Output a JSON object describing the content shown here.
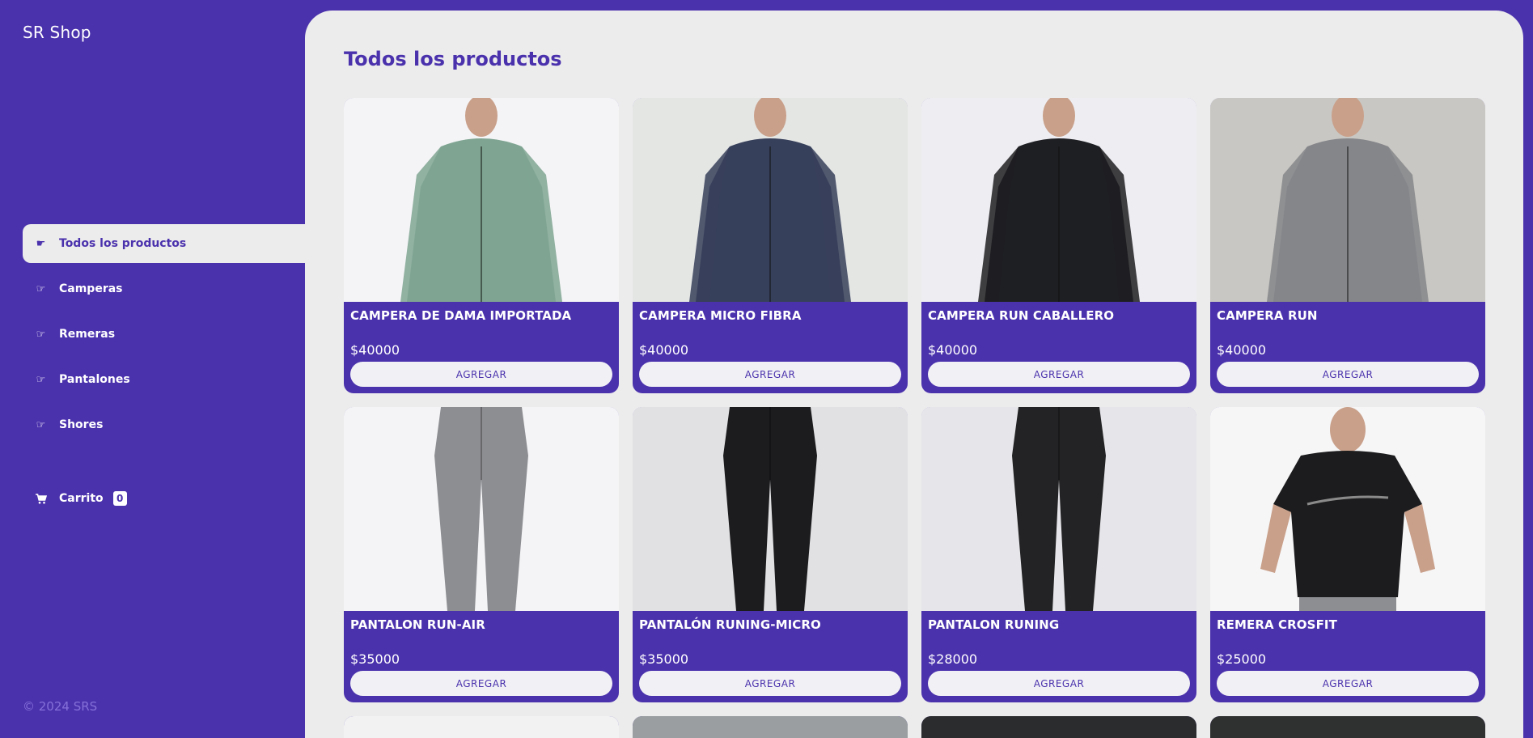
{
  "app": {
    "title": "SR Shop",
    "footer": "© 2024 SRS"
  },
  "nav": [
    {
      "label": "Todos los productos",
      "icon": "pointing-hand-icon",
      "active": true
    },
    {
      "label": "Camperas",
      "icon": "pointing-hand-outline-icon",
      "active": false
    },
    {
      "label": "Remeras",
      "icon": "pointing-hand-outline-icon",
      "active": false
    },
    {
      "label": "Pantalones",
      "icon": "pointing-hand-outline-icon",
      "active": false
    },
    {
      "label": "Shores",
      "icon": "pointing-hand-outline-icon",
      "active": false
    }
  ],
  "cart": {
    "label": "Carrito",
    "count": "0",
    "icon": "cart-icon"
  },
  "main": {
    "title": "Todos los productos"
  },
  "products": [
    {
      "name": "CAMPERA DE DAMA IMPORTADA",
      "price": "$40000",
      "button": "AGREGAR",
      "garment": "jacket",
      "color": "#7fa592",
      "bg": "#f4f4f6"
    },
    {
      "name": "CAMPERA MICRO FIBRA",
      "price": "$40000",
      "button": "AGREGAR",
      "garment": "jacket",
      "color": "#37405a",
      "bg": "#e4e6e4"
    },
    {
      "name": "CAMPERA RUN CABALLERO",
      "price": "$40000",
      "button": "AGREGAR",
      "garment": "jacket",
      "color": "#1e1f22",
      "bg": "#eeeef2"
    },
    {
      "name": "CAMPERA RUN",
      "price": "$40000",
      "button": "AGREGAR",
      "garment": "jacket",
      "color": "#85868a",
      "bg": "#c9c7c3"
    },
    {
      "name": "PANTALON RUN-AIR",
      "price": "$35000",
      "button": "AGREGAR",
      "garment": "pants",
      "color": "#8d8e92",
      "bg": "#f4f4f6"
    },
    {
      "name": "PANTALÓN RUNING-MICRO",
      "price": "$35000",
      "button": "AGREGAR",
      "garment": "pants",
      "color": "#1c1c1e",
      "bg": "#e1e1e3"
    },
    {
      "name": "PANTALON RUNING",
      "price": "$28000",
      "button": "AGREGAR",
      "garment": "pants",
      "color": "#232325",
      "bg": "#e6e6ea"
    },
    {
      "name": "REMERA CROSFIT",
      "price": "$25000",
      "button": "AGREGAR",
      "garment": "shirt",
      "color": "#1c1c1e",
      "bg": "#f6f6f7"
    }
  ],
  "partial_products": [
    {
      "bg": "#f2f2f3"
    },
    {
      "bg": "#9a9ea0"
    },
    {
      "bg": "#2a2c2e"
    },
    {
      "bg": "#2f3030"
    }
  ]
}
